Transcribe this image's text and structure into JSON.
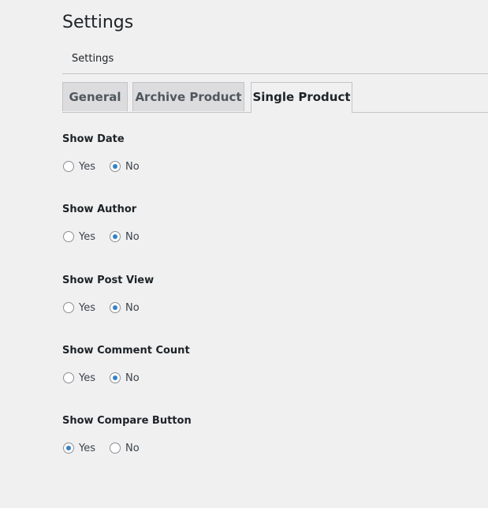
{
  "page": {
    "title": "Settings"
  },
  "subnav": {
    "item": "Settings"
  },
  "tabs": [
    {
      "label": "General",
      "active": false
    },
    {
      "label": "Archive Product",
      "active": false
    },
    {
      "label": "Single Product",
      "active": true
    }
  ],
  "fields": [
    {
      "label": "Show Date",
      "selected": "No",
      "options": [
        "Yes",
        "No"
      ]
    },
    {
      "label": "Show Author",
      "selected": "No",
      "options": [
        "Yes",
        "No"
      ]
    },
    {
      "label": "Show Post View",
      "selected": "No",
      "options": [
        "Yes",
        "No"
      ]
    },
    {
      "label": "Show Comment Count",
      "selected": "No",
      "options": [
        "Yes",
        "No"
      ]
    },
    {
      "label": "Show Compare Button",
      "selected": "Yes",
      "options": [
        "Yes",
        "No"
      ]
    }
  ],
  "colors": {
    "background": "#f0f0f1",
    "accent": "#3582c4",
    "border": "#c3c4c7",
    "inactive_tab": "#dcdcde"
  }
}
